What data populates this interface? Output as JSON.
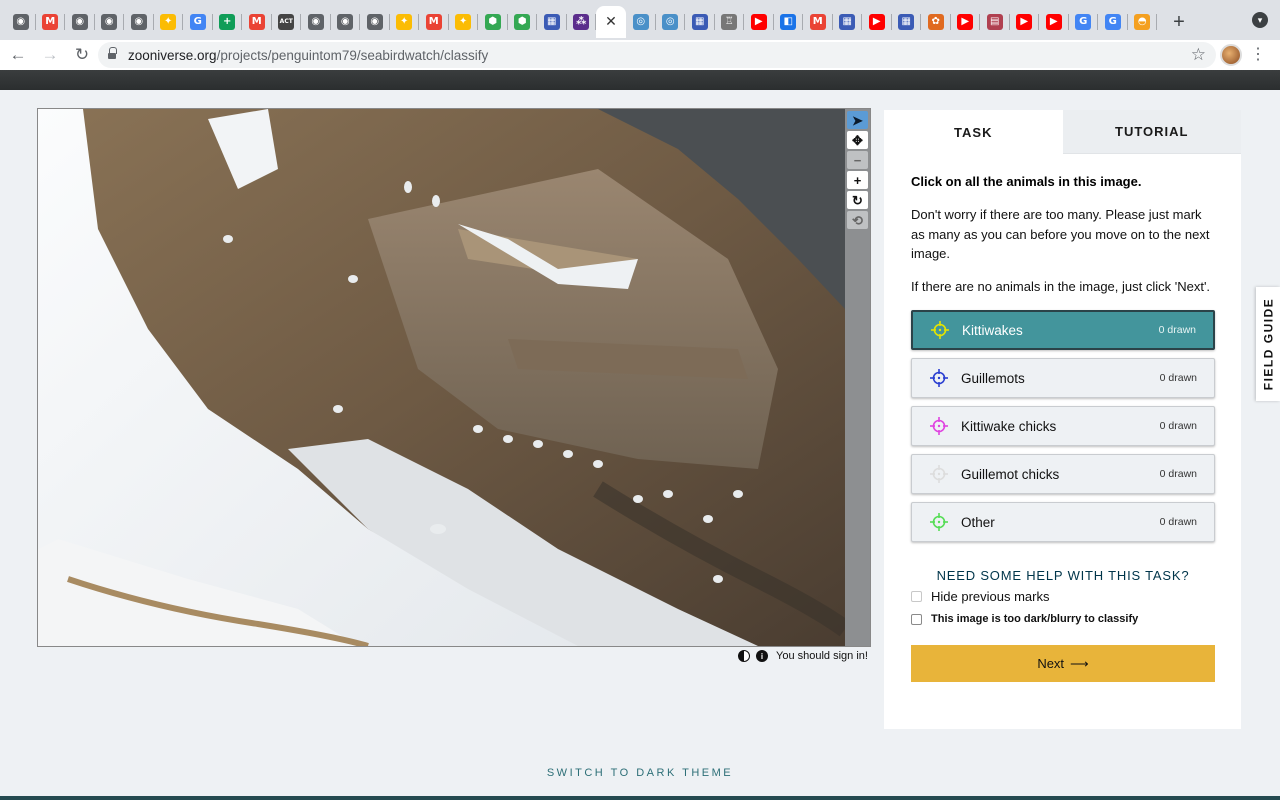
{
  "browser": {
    "tabs": [
      {
        "icon": "globe-icon",
        "color": "#5f6368",
        "glyph": "◉"
      },
      {
        "icon": "gmail-icon",
        "color": "#ea4335",
        "glyph": "M"
      },
      {
        "icon": "globe-icon",
        "color": "#5f6368",
        "glyph": "◉"
      },
      {
        "icon": "globe-icon",
        "color": "#5f6368",
        "glyph": "◉"
      },
      {
        "icon": "globe-icon",
        "color": "#5f6368",
        "glyph": "◉"
      },
      {
        "icon": "photos-icon",
        "color": "#fbbc04",
        "glyph": "✦"
      },
      {
        "icon": "google-icon",
        "color": "#4285f4",
        "glyph": "G"
      },
      {
        "icon": "sheets-plus-icon",
        "color": "#0f9d58",
        "glyph": "+"
      },
      {
        "icon": "gmail-icon",
        "color": "#ea4335",
        "glyph": "M"
      },
      {
        "icon": "act-icon",
        "color": "#444444",
        "glyph": "ACT"
      },
      {
        "icon": "globe-icon",
        "color": "#5f6368",
        "glyph": "◉"
      },
      {
        "icon": "globe-icon",
        "color": "#5f6368",
        "glyph": "◉"
      },
      {
        "icon": "globe-icon",
        "color": "#5f6368",
        "glyph": "◉"
      },
      {
        "icon": "photos-icon",
        "color": "#fbbc04",
        "glyph": "✦"
      },
      {
        "icon": "gmail-icon",
        "color": "#ea4335",
        "glyph": "M"
      },
      {
        "icon": "photos-icon",
        "color": "#fbbc04",
        "glyph": "✦"
      },
      {
        "icon": "shield-green-icon",
        "color": "#34a853",
        "glyph": "⬢"
      },
      {
        "icon": "shield-green-icon",
        "color": "#34a853",
        "glyph": "⬢"
      },
      {
        "icon": "calendar-app-icon",
        "color": "#3b5bb5",
        "glyph": "▦"
      },
      {
        "icon": "zooniverse-icon",
        "color": "#5b2d8c",
        "glyph": "⁂"
      },
      {
        "icon": "close-icon",
        "color": "#ffffff",
        "glyph": "✕",
        "active": true
      },
      {
        "icon": "compass-icon",
        "color": "#4a90c8",
        "glyph": "◎"
      },
      {
        "icon": "compass-icon",
        "color": "#4a90c8",
        "glyph": "◎"
      },
      {
        "icon": "calendar-app-icon",
        "color": "#3b5bb5",
        "glyph": "▦"
      },
      {
        "icon": "trophy-icon",
        "color": "#777777",
        "glyph": "♖"
      },
      {
        "icon": "youtube-icon",
        "color": "#ff0000",
        "glyph": "▶"
      },
      {
        "icon": "meet-icon",
        "color": "#1a73e8",
        "glyph": "◧"
      },
      {
        "icon": "gmail-icon",
        "color": "#ea4335",
        "glyph": "M"
      },
      {
        "icon": "calendar-app-icon",
        "color": "#3b5bb5",
        "glyph": "▦"
      },
      {
        "icon": "youtube-icon",
        "color": "#ff0000",
        "glyph": "▶"
      },
      {
        "icon": "calendar-app-icon",
        "color": "#3b5bb5",
        "glyph": "▦"
      },
      {
        "icon": "paw-icon",
        "color": "#e06a20",
        "glyph": "✿"
      },
      {
        "icon": "youtube-icon",
        "color": "#ff0000",
        "glyph": "▶"
      },
      {
        "icon": "book-icon",
        "color": "#b04050",
        "glyph": "▤"
      },
      {
        "icon": "youtube-icon",
        "color": "#ff0000",
        "glyph": "▶"
      },
      {
        "icon": "youtube-icon",
        "color": "#ff0000",
        "glyph": "▶"
      },
      {
        "icon": "google-icon",
        "color": "#4285f4",
        "glyph": "G"
      },
      {
        "icon": "google-icon",
        "color": "#4285f4",
        "glyph": "G"
      },
      {
        "icon": "rainbow-icon",
        "color": "#f4a020",
        "glyph": "◓"
      }
    ],
    "url_domain": "zooniverse.org",
    "url_path": "/projects/penguintom79/seabirdwatch/classify"
  },
  "viewer": {
    "tools": [
      {
        "icon": "pointer-arrow-icon",
        "glyph": "➤",
        "state": "active"
      },
      {
        "icon": "move-arrows-icon",
        "glyph": "✥",
        "state": "normal"
      },
      {
        "icon": "zoom-out-icon",
        "glyph": "−",
        "state": "disabled"
      },
      {
        "icon": "zoom-in-icon",
        "glyph": "+",
        "state": "normal"
      },
      {
        "icon": "rotate-icon",
        "glyph": "↻",
        "state": "normal"
      },
      {
        "icon": "reset-icon",
        "glyph": "⟲",
        "state": "disabled"
      }
    ],
    "sign_in_text": "You should sign in!"
  },
  "panel": {
    "tab_task": "TASK",
    "tab_tutorial": "TUTORIAL",
    "instruction_title": "Click on all the animals in this image.",
    "instruction_p1": "Don't worry if there are too many. Please just mark as many as you can before you move on to the next image.",
    "instruction_p2": "If there are no animals in the image, just click 'Next'.",
    "choices": [
      {
        "label": "Kittiwakes",
        "count": "0 drawn",
        "color": "#e5e500",
        "active": true
      },
      {
        "label": "Guillemots",
        "count": "0 drawn",
        "color": "#2a3fd1",
        "active": false
      },
      {
        "label": "Kittiwake chicks",
        "count": "0 drawn",
        "color": "#e044e0",
        "active": false
      },
      {
        "label": "Guillemot chicks",
        "count": "0 drawn",
        "color": "#dddddd",
        "active": false
      },
      {
        "label": "Other",
        "count": "0 drawn",
        "color": "#55dd55",
        "active": false
      }
    ],
    "help_text": "NEED SOME HELP WITH THIS TASK?",
    "hide_marks_label": "Hide previous marks",
    "too_dark_label": "This image is too dark/blurry to classify",
    "next_label": "Next",
    "next_arrow": "⟶"
  },
  "field_guide": "FIELD GUIDE",
  "dark_theme_label": "SWITCH TO DARK THEME"
}
